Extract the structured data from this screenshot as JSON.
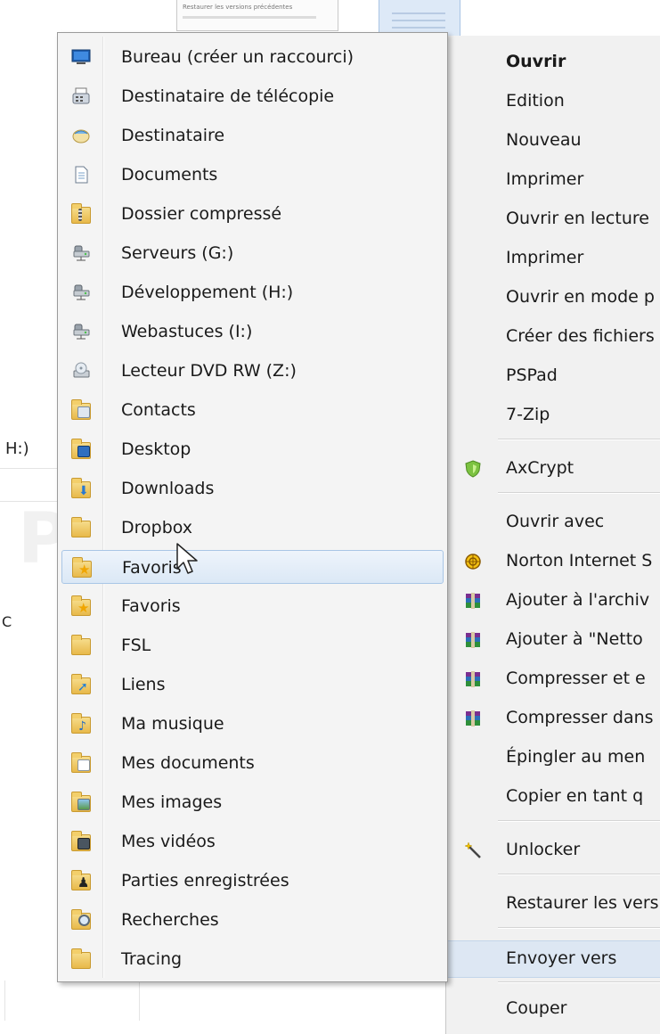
{
  "background": {
    "doc_text": "Restaurer les versions précédentes",
    "left_label": "H:)",
    "left_mark": "C"
  },
  "watermark": "PC ASTUCES",
  "context_menu": {
    "items": [
      {
        "label": "Ouvrir",
        "bold": true,
        "icon": ""
      },
      {
        "label": "Edition",
        "icon": ""
      },
      {
        "label": "Nouveau",
        "icon": ""
      },
      {
        "label": "Imprimer",
        "icon": ""
      },
      {
        "label": "Ouvrir en lecture",
        "icon": ""
      },
      {
        "label": "Imprimer",
        "icon": ""
      },
      {
        "label": "Ouvrir en mode p",
        "icon": ""
      },
      {
        "label": "Créer des fichiers",
        "icon": ""
      },
      {
        "label": "PSPad",
        "icon": ""
      },
      {
        "label": "7-Zip",
        "icon": ""
      },
      {
        "label": "AxCrypt",
        "icon": "axcrypt-shield-icon"
      },
      {
        "label": "Ouvrir avec",
        "icon": ""
      },
      {
        "label": "Norton Internet S",
        "icon": "norton-icon"
      },
      {
        "label": "Ajouter à l'archiv",
        "icon": "winrar-icon"
      },
      {
        "label": "Ajouter à \"Netto",
        "icon": "winrar-icon"
      },
      {
        "label": "Compresser et e",
        "icon": "winrar-icon"
      },
      {
        "label": "Compresser dans",
        "icon": "winrar-icon"
      },
      {
        "label": "Épingler au men",
        "icon": ""
      },
      {
        "label": "Copier en tant q",
        "icon": ""
      },
      {
        "label": "Unlocker",
        "icon": "unlocker-wand-icon"
      },
      {
        "label": "Restaurer les vers",
        "icon": ""
      },
      {
        "label": "Envoyer vers",
        "icon": "",
        "highlighted": true
      },
      {
        "label": "Couper",
        "icon": ""
      }
    ]
  },
  "send_to_menu": {
    "items": [
      {
        "label": "Bureau (créer un raccourci)",
        "icon": "desktop-icon"
      },
      {
        "label": "Destinataire de télécopie",
        "icon": "fax-icon"
      },
      {
        "label": "Destinataire",
        "icon": "mail-recipient-icon"
      },
      {
        "label": "Documents",
        "icon": "documents-icon"
      },
      {
        "label": "Dossier compressé",
        "icon": "zip-folder-icon"
      },
      {
        "label": "Serveurs (G:)",
        "icon": "network-drive-icon"
      },
      {
        "label": "Développement (H:)",
        "icon": "network-drive-icon"
      },
      {
        "label": "Webastuces (I:)",
        "icon": "network-drive-icon"
      },
      {
        "label": "Lecteur DVD RW (Z:)",
        "icon": "dvd-drive-icon"
      },
      {
        "label": "Contacts",
        "icon": "contacts-folder-icon"
      },
      {
        "label": "Desktop",
        "icon": "desktop-folder-icon"
      },
      {
        "label": "Downloads",
        "icon": "downloads-folder-icon"
      },
      {
        "label": "Dropbox",
        "icon": "folder-icon"
      },
      {
        "label": "Favoris",
        "icon": "favorites-folder-icon",
        "highlighted": true
      },
      {
        "label": "Favoris",
        "icon": "favorites-folder-icon"
      },
      {
        "label": "FSL",
        "icon": "folder-icon"
      },
      {
        "label": "Liens",
        "icon": "links-folder-icon"
      },
      {
        "label": "Ma musique",
        "icon": "music-folder-icon"
      },
      {
        "label": "Mes documents",
        "icon": "documents-folder-icon"
      },
      {
        "label": "Mes images",
        "icon": "pictures-folder-icon"
      },
      {
        "label": "Mes vidéos",
        "icon": "videos-folder-icon"
      },
      {
        "label": "Parties enregistrées",
        "icon": "saved-games-folder-icon"
      },
      {
        "label": "Recherches",
        "icon": "searches-folder-icon"
      },
      {
        "label": "Tracing",
        "icon": "folder-icon"
      }
    ]
  }
}
